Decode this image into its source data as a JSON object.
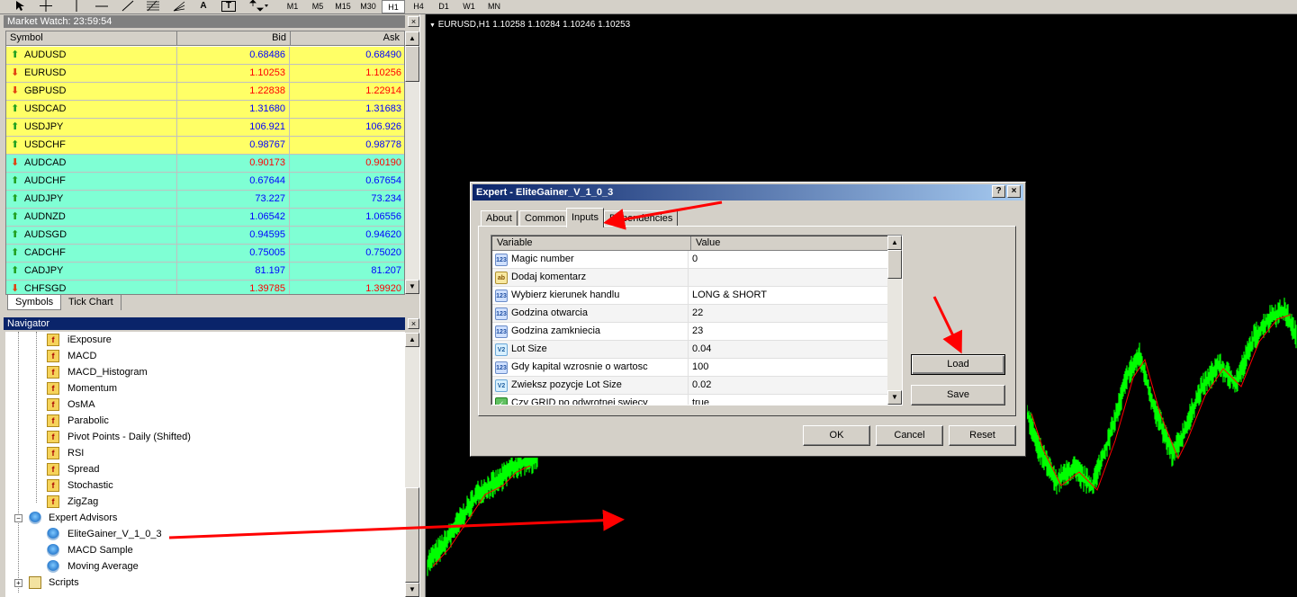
{
  "toolbar": {
    "icons": [
      "cursor-icon",
      "crosshair-icon",
      "vertical-line-icon",
      "horizontal-line-icon",
      "trendline-icon",
      "fibonacci-icon",
      "fibo-fan-icon",
      "text-icon",
      "text-label-icon",
      "arrows-icon"
    ],
    "text_labels": {
      "text": "A",
      "label": "T"
    },
    "timeframes": [
      "M1",
      "M5",
      "M15",
      "M30",
      "H1",
      "H4",
      "D1",
      "W1",
      "MN"
    ],
    "active_timeframe": "H1"
  },
  "market_watch": {
    "title": "Market Watch: 23:59:54",
    "columns": [
      "Symbol",
      "Bid",
      "Ask"
    ],
    "rows": [
      {
        "symbol": "AUDUSD",
        "bid": "0.68486",
        "ask": "0.68490",
        "dir": "up",
        "group": "major"
      },
      {
        "symbol": "EURUSD",
        "bid": "1.10253",
        "ask": "1.10256",
        "dir": "down",
        "group": "major"
      },
      {
        "symbol": "GBPUSD",
        "bid": "1.22838",
        "ask": "1.22914",
        "dir": "down",
        "group": "major"
      },
      {
        "symbol": "USDCAD",
        "bid": "1.31680",
        "ask": "1.31683",
        "dir": "up",
        "group": "major"
      },
      {
        "symbol": "USDJPY",
        "bid": "106.921",
        "ask": "106.926",
        "dir": "up",
        "group": "major"
      },
      {
        "symbol": "USDCHF",
        "bid": "0.98767",
        "ask": "0.98778",
        "dir": "up",
        "group": "major"
      },
      {
        "symbol": "AUDCAD",
        "bid": "0.90173",
        "ask": "0.90190",
        "dir": "down",
        "group": "cross"
      },
      {
        "symbol": "AUDCHF",
        "bid": "0.67644",
        "ask": "0.67654",
        "dir": "up",
        "group": "cross"
      },
      {
        "symbol": "AUDJPY",
        "bid": "73.227",
        "ask": "73.234",
        "dir": "up",
        "group": "cross"
      },
      {
        "symbol": "AUDNZD",
        "bid": "1.06542",
        "ask": "1.06556",
        "dir": "up",
        "group": "cross"
      },
      {
        "symbol": "AUDSGD",
        "bid": "0.94595",
        "ask": "0.94620",
        "dir": "up",
        "group": "cross"
      },
      {
        "symbol": "CADCHF",
        "bid": "0.75005",
        "ask": "0.75020",
        "dir": "up",
        "group": "cross"
      },
      {
        "symbol": "CADJPY",
        "bid": "81.197",
        "ask": "81.207",
        "dir": "up",
        "group": "cross"
      },
      {
        "symbol": "CHFSGD",
        "bid": "1.39785",
        "ask": "1.39920",
        "dir": "down",
        "group": "cross"
      }
    ],
    "tabs": [
      "Symbols",
      "Tick Chart"
    ],
    "close": "×",
    "colors": {
      "major": "#ffff66",
      "cross": "#7fffd4",
      "up_text": "#0000ff",
      "down_text": "#ff0000",
      "up_arrow": "#20a020",
      "down_arrow": "#e04010"
    }
  },
  "navigator": {
    "title": "Navigator",
    "close": "×",
    "indicators": [
      "iExposure",
      "MACD",
      "MACD_Histogram",
      "Momentum",
      "OsMA",
      "Parabolic",
      "Pivot Points - Daily (Shifted)",
      "RSI",
      "Spread",
      "Stochastic",
      "ZigZag"
    ],
    "expert_advisors_label": "Expert Advisors",
    "experts": [
      "EliteGainer_V_1_0_3",
      "MACD Sample",
      "Moving Average"
    ],
    "scripts_label": "Scripts",
    "collapse_glyph": "−",
    "expand_glyph": "+"
  },
  "chart": {
    "label": "EURUSD,H1  1.10258 1.10284 1.10246 1.10253",
    "marker": "▼",
    "colors": {
      "background": "#000000",
      "bars": "#00ff00",
      "ma": "#ff0000"
    }
  },
  "dialog": {
    "title": "Expert - EliteGainer_V_1_0_3",
    "help": "?",
    "close": "×",
    "tabs": [
      "About",
      "Common",
      "Inputs",
      "Dependencies"
    ],
    "active_tab": "Inputs",
    "columns": [
      "Variable",
      "Value"
    ],
    "inputs": [
      {
        "type": "int",
        "icon": "123",
        "name": "Magic number",
        "value": "0"
      },
      {
        "type": "string",
        "icon": "ab",
        "name": "Dodaj komentarz",
        "value": ""
      },
      {
        "type": "int",
        "icon": "123",
        "name": "Wybierz kierunek handlu",
        "value": "LONG & SHORT"
      },
      {
        "type": "int",
        "icon": "123",
        "name": "Godzina otwarcia",
        "value": "22"
      },
      {
        "type": "int",
        "icon": "123",
        "name": "Godzina zamkniecia",
        "value": "23"
      },
      {
        "type": "double",
        "icon": "V2",
        "name": "Lot Size",
        "value": "0.04"
      },
      {
        "type": "int",
        "icon": "123",
        "name": "Gdy kapital wzrosnie o wartosc",
        "value": "100"
      },
      {
        "type": "double",
        "icon": "V2",
        "name": "Zwieksz pozycje Lot Size",
        "value": "0.02"
      },
      {
        "type": "bool",
        "icon": "✓",
        "name": "Czy GRID po odwrotnej swiecy",
        "value": "true"
      }
    ],
    "buttons": {
      "load": "Load",
      "save": "Save",
      "ok": "OK",
      "cancel": "Cancel",
      "reset": "Reset"
    }
  },
  "annotations": {
    "arrow_color": "#ff0000"
  }
}
